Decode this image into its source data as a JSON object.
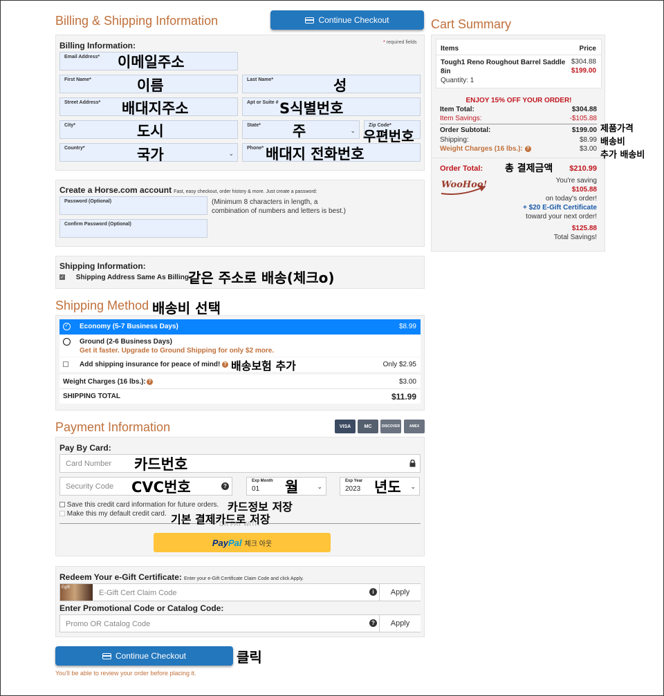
{
  "billing": {
    "title": "Billing & Shipping Information",
    "section_label": "Billing Information:",
    "required_note": "required fields",
    "required_star": "*",
    "fields": {
      "email": "Email Address*",
      "first_name": "First Name*",
      "last_name": "Last Name*",
      "street": "Street Address*",
      "apt": "Apt or Suite #",
      "city": "City*",
      "state": "State*",
      "zip": "Zip Code*",
      "country": "Country*",
      "phone": "Phone*"
    }
  },
  "top_checkout_button": "Continue Checkout",
  "account": {
    "title": "Create a Horse.com account",
    "subtitle": "Fast, easy checkout, order history & more. Just create a password:",
    "password_label": "Password (Optional)",
    "confirm_label": "Confirm Password (Optional)",
    "hint_line1": "(Minimum 8 characters in length, a",
    "hint_line2": "combination of numbers and letters is best.)"
  },
  "shipping_info": {
    "title": "Shipping Information:",
    "same_as_billing": "Shipping Address Same As Billing",
    "same_checked": true
  },
  "shipping_method": {
    "title": "Shipping Method",
    "economy": {
      "label": "Economy (5-7 Business Days)",
      "price": "$8.99",
      "selected": true
    },
    "ground": {
      "label": "Ground (2-6 Business Days)",
      "upsell": "Get it faster. Upgrade to Ground Shipping for only $2 more."
    },
    "insurance": {
      "label": "Add shipping insurance for peace of mind!",
      "price": "Only $2.95"
    },
    "weight_label": "Weight Charges (16 lbs.):",
    "weight_value": "$3.00",
    "total_label": "SHIPPING TOTAL",
    "total_value": "$11.99"
  },
  "payment": {
    "title": "Payment Information",
    "pay_by_card": "Pay By Card:",
    "card_number_placeholder": "Card Number",
    "security_placeholder": "Security Code",
    "exp_month_label": "Exp Month",
    "exp_month_value": "01",
    "exp_year_label": "Exp Year",
    "exp_year_value": "2023",
    "save_card": "Save this credit card information for future orders.",
    "default_card": "Make this my default credit card.",
    "or_pay_with": "OR PAY WITH",
    "paypal_pay": "Pay",
    "paypal_pal": "Pal",
    "paypal_suffix": "체크 아웃",
    "card_logos": [
      "VISA",
      "MC",
      "DISCOVER",
      "AMEX"
    ]
  },
  "redeem": {
    "egift_title": "Redeem Your e-Gift Certificate:",
    "egift_note": "Enter your e-Gift Certificate Claim Code and click Apply.",
    "egift_placeholder": "E-Gift Cert Claim Code",
    "egift_thumb": "Egift",
    "apply": "Apply",
    "promo_title": "Enter Promotional Code or Catalog Code:",
    "promo_placeholder": "Promo OR Catalog Code"
  },
  "bottom_checkout_button": "Continue Checkout",
  "review_note": "You'll be able to review your order before placing it.",
  "cart": {
    "title": "Cart Summary",
    "col_items": "Items",
    "col_price": "Price",
    "product_name_l1": "Tough1 Reno Roughout Barrel Saddle",
    "product_name_l2": "8in",
    "product_orig": "$304.88",
    "product_price": "$199.00",
    "quantity": "Quantity: 1",
    "promo": "ENJOY 15% OFF YOUR ORDER!",
    "item_total_label": "Item Total:",
    "item_total": "$304.88",
    "savings_label": "Item Savings:",
    "savings": "-$105.88",
    "subtotal_label": "Order Subtotal:",
    "subtotal": "$199.00",
    "shipping_label": "Shipping:",
    "shipping": "$8.99",
    "weight_label": "Weight Charges (16 lbs.):",
    "weight": "$3.00",
    "order_total_label": "Order Total:",
    "order_total": "$210.99",
    "woohoo": "WooHoo!",
    "saving_line": "You're saving",
    "saving_amount": "$105.88",
    "saving_today": "on today's order!",
    "egift_bonus": "+ $20 E-Gift Certificate",
    "next_order": "toward your next order!",
    "total_savings": "$125.88",
    "total_savings_label": "Total Savings!"
  },
  "annotations": {
    "email": "이메일주소",
    "first_name": "이름",
    "last_name": "성",
    "street": "배대지주소",
    "apt": "S식별번호",
    "city": "도시",
    "state": "주",
    "zip": "우편번호",
    "country": "국가",
    "phone": "배대지 전화번호",
    "same_address": "같은 주소로 배송(체크o)",
    "shipping_method": "배송비 선택",
    "insurance": "배송보험 추가",
    "card_number": "카드번호",
    "cvc": "CVC번호",
    "month": "월",
    "year": "년도",
    "save_card": "카드정보 저장",
    "default_card": "기본 결제카드로 저장",
    "click": "클릭",
    "product_price": "제품가격",
    "shipping_cost": "배송비",
    "extra_shipping": "추가 배송비",
    "total_payment": "총 결제금액"
  },
  "icons": {
    "required": "asterisk",
    "help": "question-icon",
    "info": "info-icon",
    "lock": "lock-icon",
    "card": "credit-card-icon",
    "radio_selected": "check-circle-icon"
  },
  "colors": {
    "accent_orange": "#c0703b",
    "button_blue": "#2377bd",
    "selected_blue": "#0a84ff",
    "price_red": "#c0161e",
    "paypal_yellow": "#ffc439"
  }
}
